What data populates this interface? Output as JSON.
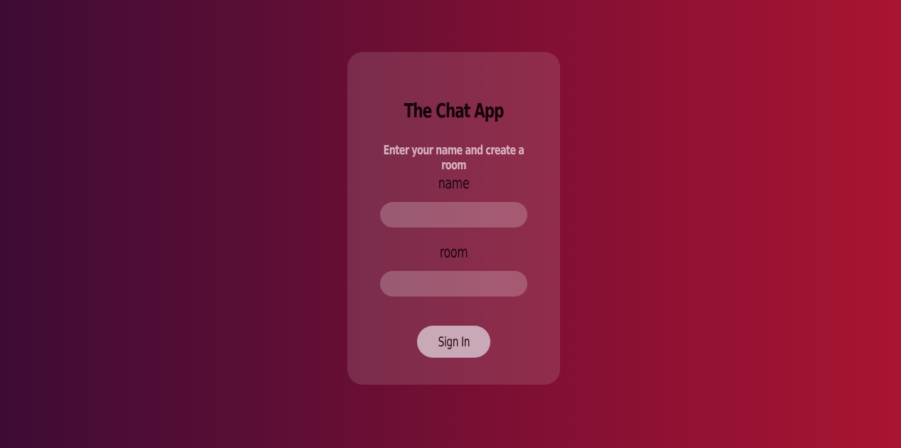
{
  "app": {
    "title": "The Chat App",
    "subtitle": "Enter your name and create a room"
  },
  "form": {
    "name_label": "name",
    "name_value": "",
    "room_label": "room",
    "room_value": "",
    "submit_label": "Sign In"
  },
  "colors": {
    "background_left": "#3e0b35",
    "background_right": "#a91431",
    "button": "#c9a8b8"
  }
}
